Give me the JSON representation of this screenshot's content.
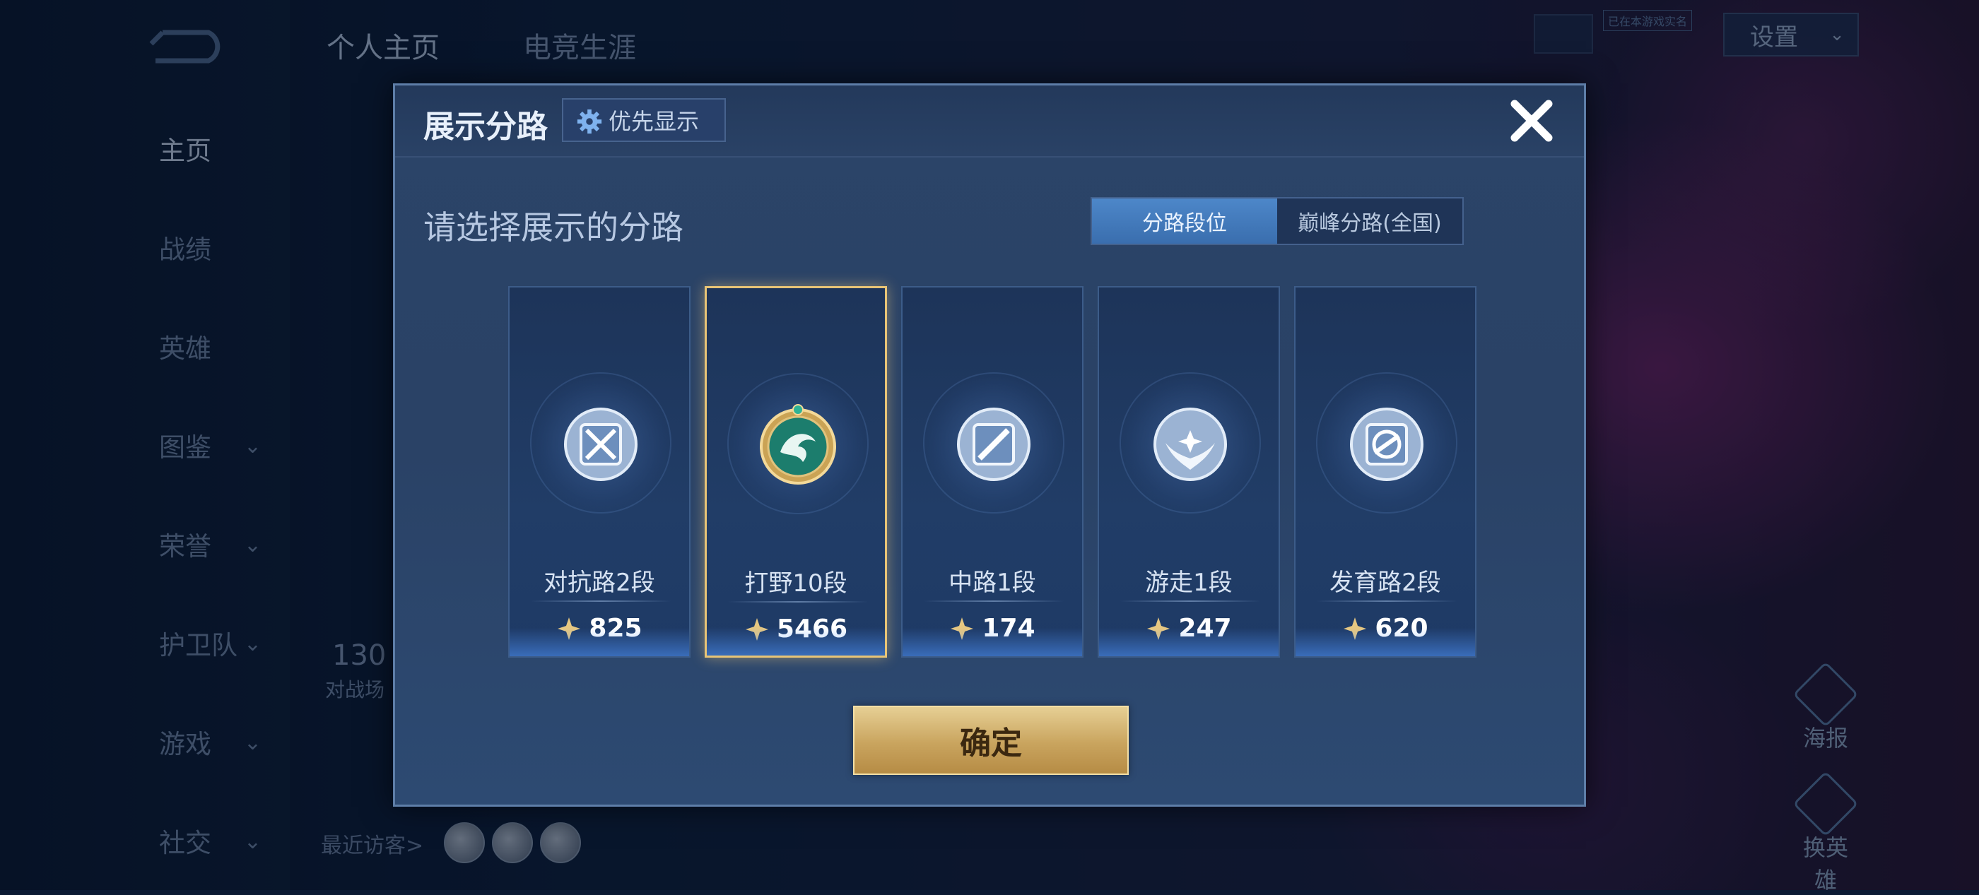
{
  "background": {
    "top_tabs": [
      "个人主页",
      "电竞生涯"
    ],
    "settings_label": "设置",
    "badge_text": "已在本游戏实名",
    "nav": [
      {
        "label": "主页",
        "active": true,
        "chevron": false
      },
      {
        "label": "战绩",
        "active": false,
        "chevron": false
      },
      {
        "label": "英雄",
        "active": false,
        "chevron": false
      },
      {
        "label": "图鉴",
        "active": false,
        "chevron": true
      },
      {
        "label": "荣誉",
        "active": false,
        "chevron": true
      },
      {
        "label": "护卫队",
        "active": false,
        "chevron": true
      },
      {
        "label": "游戏",
        "active": false,
        "chevron": true
      },
      {
        "label": "社交",
        "active": false,
        "chevron": true
      }
    ],
    "stat_value": "130",
    "stat_label": "对战场",
    "recent_visitors": "最近访客>",
    "side_buttons": [
      "海报",
      "换英雄"
    ]
  },
  "modal": {
    "title": "展示分路",
    "priority_button": "优先显示",
    "subtitle": "请选择展示的分路",
    "toggle": {
      "options": [
        "分路段位",
        "巅峰分路(全国)"
      ],
      "selected": 0
    },
    "lanes": [
      {
        "name": "对抗路2段",
        "score": "825",
        "icon": "clash-lane-badge",
        "selected": false
      },
      {
        "name": "打野10段",
        "score": "5466",
        "icon": "jungle-dragon-badge",
        "selected": true
      },
      {
        "name": "中路1段",
        "score": "174",
        "icon": "mid-lane-badge",
        "selected": false
      },
      {
        "name": "游走1段",
        "score": "247",
        "icon": "roam-wings-badge",
        "selected": false
      },
      {
        "name": "发育路2段",
        "score": "620",
        "icon": "farm-lane-badge",
        "selected": false
      }
    ],
    "confirm_label": "确定"
  },
  "colors": {
    "accent_gold": "#e8c476",
    "toggle_selected": "#4d87c9",
    "modal_bg": "#2a4266"
  }
}
